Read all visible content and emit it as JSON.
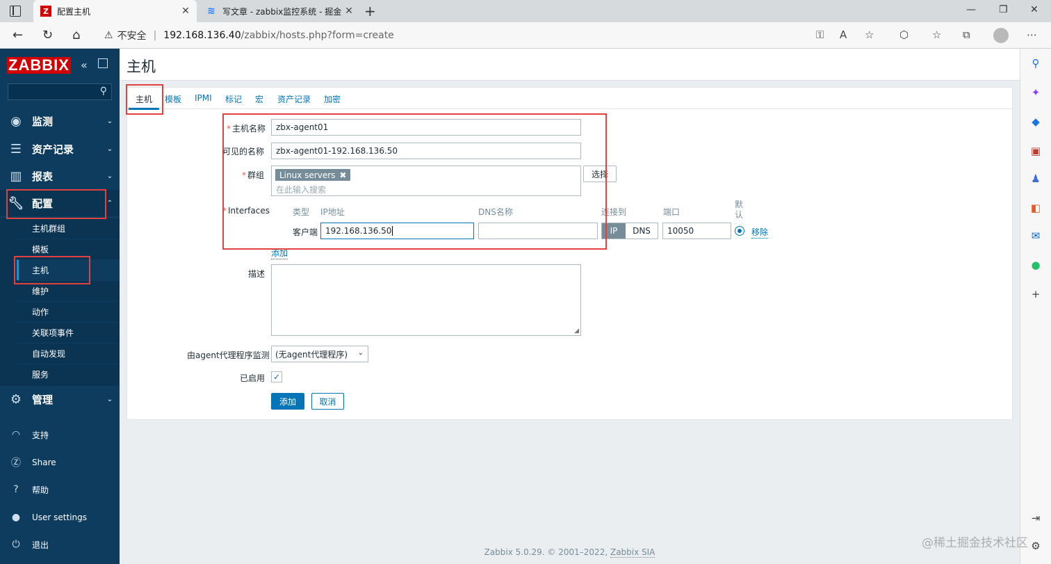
{
  "browser": {
    "tabs": [
      {
        "title": "配置主机",
        "favicon": "Z"
      },
      {
        "title": "写文章 - zabbix监控系统 - 掘金",
        "favicon": "≋"
      }
    ],
    "address": {
      "warning": "不安全",
      "host": "192.168.136.40",
      "path": "/zabbix/hosts.php?form=create"
    }
  },
  "sidebar": {
    "logo": "ZABBIX",
    "menu": [
      {
        "label": "监测",
        "icon": "eye-icon"
      },
      {
        "label": "资产记录",
        "icon": "list-icon"
      },
      {
        "label": "报表",
        "icon": "bar-chart-icon"
      },
      {
        "label": "配置",
        "icon": "wrench-icon"
      },
      {
        "label": "管理",
        "icon": "gear-icon"
      }
    ],
    "submenu": [
      "主机群组",
      "模板",
      "主机",
      "维护",
      "动作",
      "关联项事件",
      "自动发现",
      "服务"
    ],
    "bottom": [
      {
        "label": "支持",
        "icon": "headset-icon"
      },
      {
        "label": "Share",
        "icon": "share-icon"
      },
      {
        "label": "帮助",
        "icon": "help-icon"
      },
      {
        "label": "User settings",
        "icon": "user-icon"
      },
      {
        "label": "退出",
        "icon": "power-icon"
      }
    ]
  },
  "page": {
    "title": "主机",
    "tabs": [
      "主机",
      "模板",
      "IPMI",
      "标记",
      "宏",
      "资产记录",
      "加密"
    ]
  },
  "form": {
    "host_name_label": "主机名称",
    "host_name_value": "zbx-agent01",
    "visible_name_label": "可见的名称",
    "visible_name_value": "zbx-agent01-192.168.136.50",
    "groups_label": "群组",
    "group_tag": "Linux servers",
    "group_placeholder": "在此输入搜索",
    "select_button": "选择",
    "interfaces_label": "Interfaces",
    "interface_headers": {
      "type": "类型",
      "ip": "IP地址",
      "dns": "DNS名称",
      "connect": "连接到",
      "port": "端口",
      "default": "默认"
    },
    "interface": {
      "type": "客户端",
      "ip": "192.168.136.50",
      "dns": "",
      "connect_ip": "IP",
      "connect_dns": "DNS",
      "port": "10050",
      "remove": "移除"
    },
    "add_interface": "添加",
    "description_label": "描述",
    "proxy_label": "由agent代理程序监测",
    "proxy_value": "(无agent代理程序)",
    "enabled_label": "已启用",
    "enabled": true,
    "add_button": "添加",
    "cancel_button": "取消"
  },
  "footer": {
    "text": "Zabbix 5.0.29. © 2001–2022, ",
    "link": "Zabbix SIA"
  },
  "watermark": "@稀土掘金技术社区"
}
